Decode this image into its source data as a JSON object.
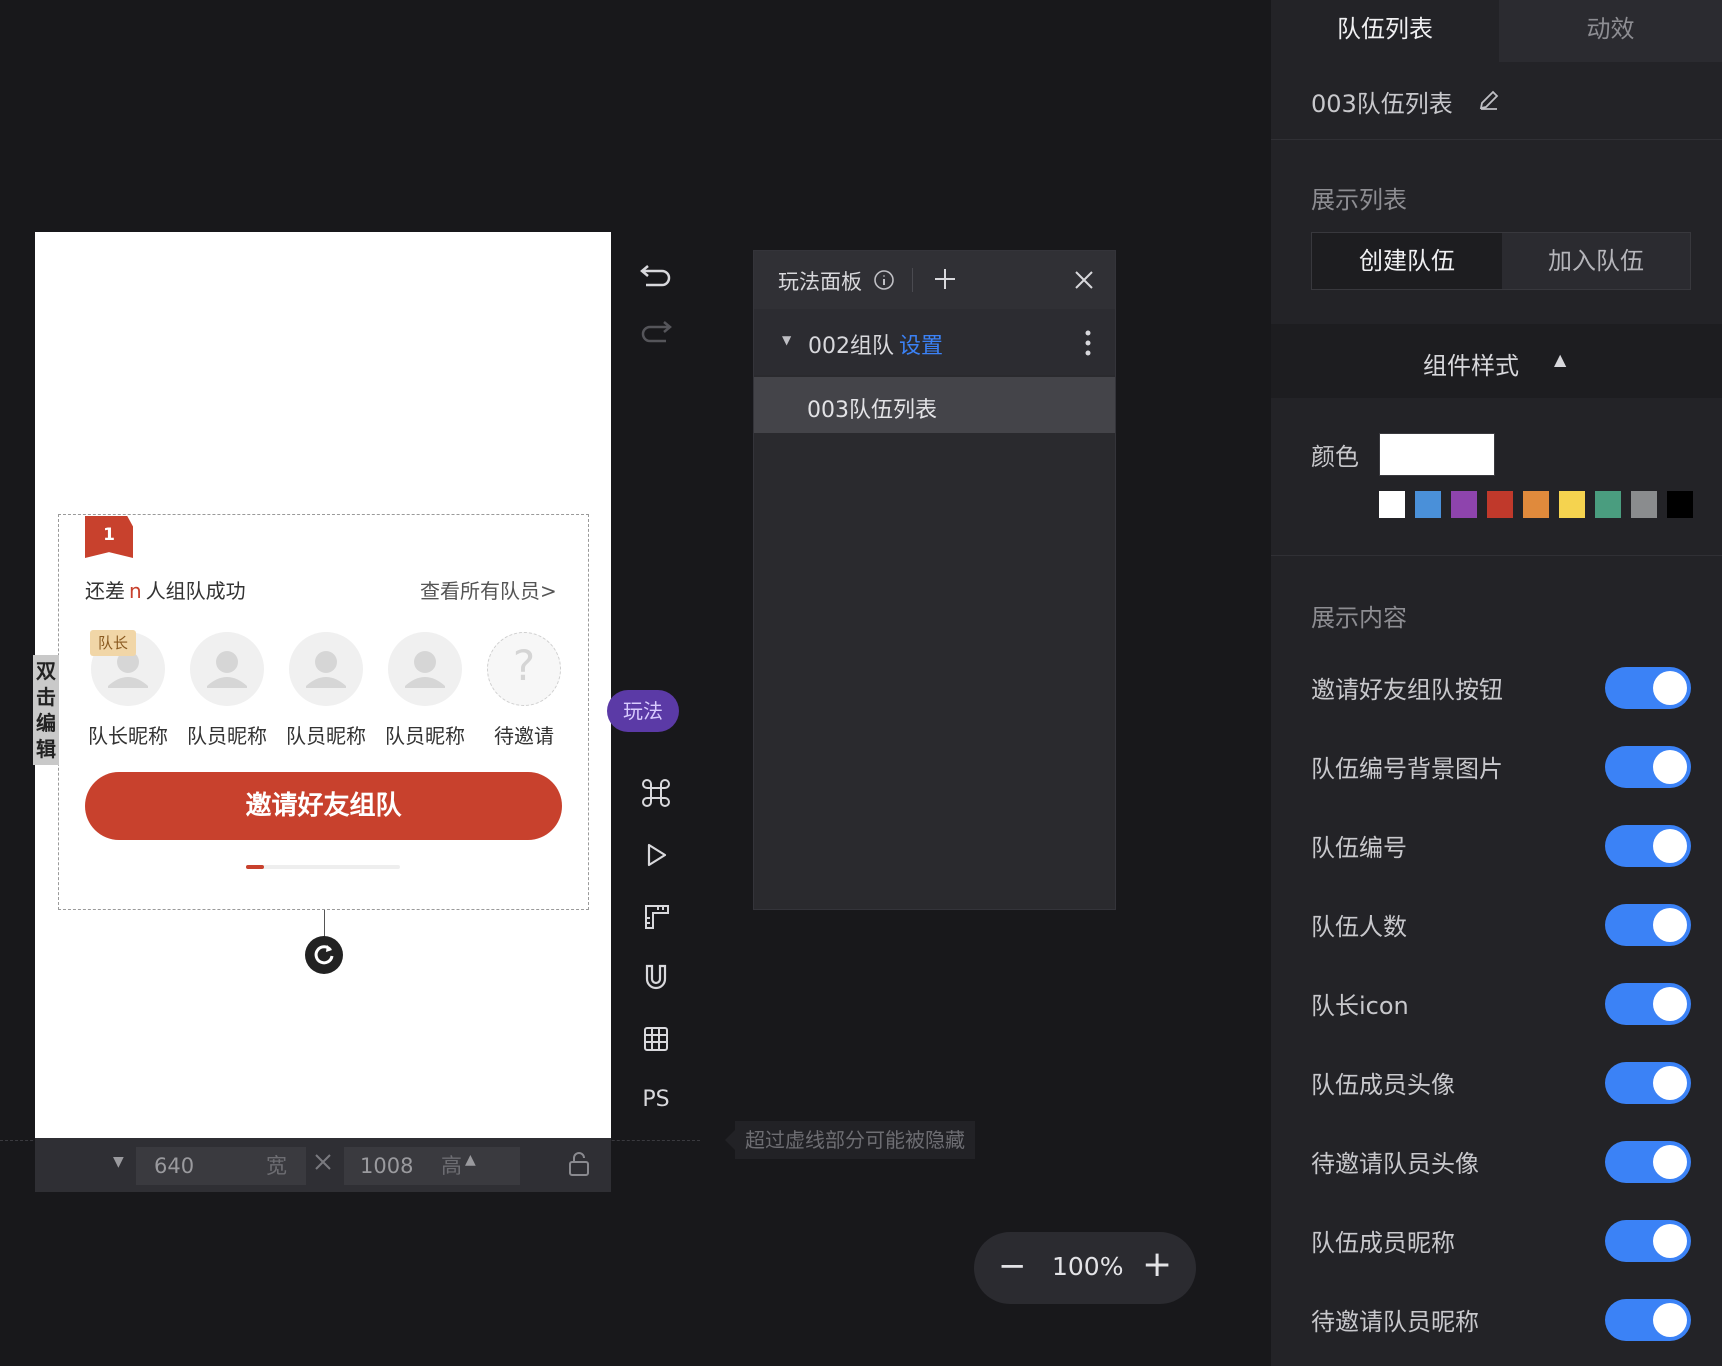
{
  "canvas": {
    "team_number": "1",
    "status_prefix": "还差",
    "status_n": "n",
    "status_suffix": "人组队成功",
    "view_all": "查看所有队员>",
    "leader_tag": "队长",
    "nicknames": [
      "队长昵称",
      "队员昵称",
      "队员昵称",
      "队员昵称",
      "待邀请"
    ],
    "pending_mark": "?",
    "invite_button": "邀请好友组队",
    "page_indicator_progress": 0.12,
    "double_click_edit": "双击编辑"
  },
  "sizebar": {
    "width_value": "640",
    "width_unit": "宽",
    "height_value": "1008",
    "height_unit": "高"
  },
  "hint": "超过虚线部分可能被隐藏",
  "toolbar": {
    "play_label": "玩法",
    "ps_label": "PS",
    "icons": [
      "undo-icon",
      "redo-icon",
      "command-icon",
      "play-icon",
      "ruler-icon",
      "magnet-icon",
      "grid-icon"
    ]
  },
  "play_panel": {
    "title": "玩法面板",
    "group_name": "002组队",
    "group_settings": "设置",
    "item": "003队伍列表"
  },
  "zoom": {
    "minus": "−",
    "value": "100%",
    "plus": "+"
  },
  "right_panel": {
    "tabs": [
      "队伍列表",
      "动效"
    ],
    "component_name": "003队伍列表",
    "display_list_title": "展示列表",
    "segments": [
      "创建队伍",
      "加入队伍"
    ],
    "style_title": "组件样式",
    "color_label": "颜色",
    "color_value": "#ffffff",
    "swatches": [
      "#ffffff",
      "#4a90d9",
      "#8e44ad",
      "#c0392b",
      "#e08a3c",
      "#f5d34f",
      "#4a9d7f",
      "#8a8c8e",
      "#000000"
    ],
    "content_title": "展示内容",
    "toggles": [
      {
        "label": "邀请好友组队按钮",
        "on": true
      },
      {
        "label": "队伍编号背景图片",
        "on": true
      },
      {
        "label": "队伍编号",
        "on": true
      },
      {
        "label": "队伍人数",
        "on": true
      },
      {
        "label": "队长icon",
        "on": true
      },
      {
        "label": "队伍成员头像",
        "on": true
      },
      {
        "label": "待邀请队员头像",
        "on": true
      },
      {
        "label": "队伍成员昵称",
        "on": true
      },
      {
        "label": "待邀请队员昵称",
        "on": true
      }
    ]
  },
  "colors": {
    "accent": "#c8412d",
    "toggle_on": "#3b82f6",
    "link": "#3b82f6",
    "play_pill": "#5b3aa6"
  }
}
